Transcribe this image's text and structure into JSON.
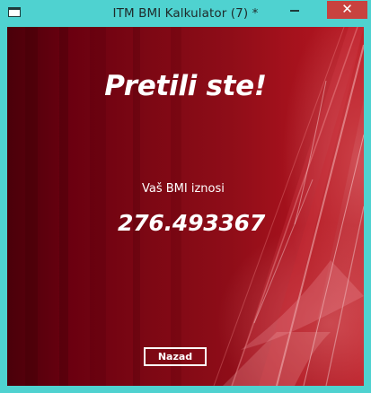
{
  "window": {
    "title": "ITM BMI Kalkulator (7) *",
    "close_glyph": "✕",
    "accent_color": "#4fd2d0",
    "close_color": "#c8423f"
  },
  "main": {
    "heading": "Pretili ste!",
    "bmi_label": "Vaš BMI iznosi",
    "bmi_value": "276.493367",
    "back_button": "Nazad"
  },
  "icons": {
    "app": "app-window-icon",
    "minimize": "minimize-icon",
    "close": "close-icon"
  }
}
